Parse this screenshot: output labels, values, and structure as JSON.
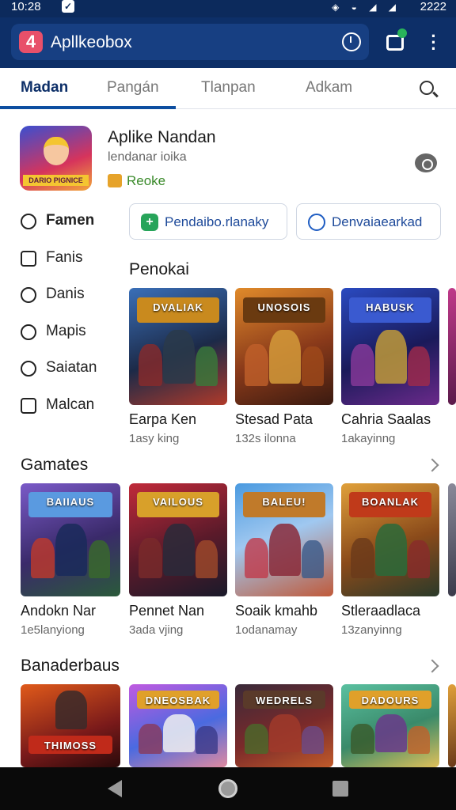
{
  "status": {
    "time": "10:28",
    "right": "2222"
  },
  "header": {
    "logo": "4",
    "title": "Apllkeobox"
  },
  "tabs": [
    {
      "label": "Madan",
      "active": true
    },
    {
      "label": "Pangán",
      "active": false
    },
    {
      "label": "Tlanpan",
      "active": false
    },
    {
      "label": "Adkam",
      "active": false
    }
  ],
  "featured": {
    "icon_text": "DARIO PIGNICE",
    "title": "Aplike Nandan",
    "subtitle": "lendanar ioika",
    "tag": "Reoke"
  },
  "side_nav": [
    {
      "label": "Famen",
      "icon": "pencil-icon",
      "active": true
    },
    {
      "label": "Fanis",
      "icon": "edit-square-icon",
      "active": false
    },
    {
      "label": "Danis",
      "icon": "user-search-icon",
      "active": false
    },
    {
      "label": "Mapis",
      "icon": "clock-icon",
      "active": false
    },
    {
      "label": "Saiatan",
      "icon": "person-icon",
      "active": false
    },
    {
      "label": "Malcan",
      "icon": "window-icon",
      "active": false
    }
  ],
  "chips": [
    {
      "label": "Pendaibo.rlanaky",
      "icon": "add-square-icon"
    },
    {
      "label": "Denvaiaearkad",
      "icon": "search-people-icon"
    }
  ],
  "sections": [
    {
      "title": "Penokai",
      "cards": [
        {
          "name": "Earpa Ken",
          "meta": "1asy king",
          "banner": "DVALIAK"
        },
        {
          "name": "Stesad Pata",
          "meta": "132s ilonna",
          "banner": "UNOSOIS"
        },
        {
          "name": "Cahria Saalas",
          "meta": "1akayinng",
          "banner": "HABUSK"
        }
      ]
    },
    {
      "title": "Gamates",
      "cards": [
        {
          "name": "Andokn Nar",
          "meta": "1e5lanyiong",
          "banner": "BAIIAUS"
        },
        {
          "name": "Pennet Nan",
          "meta": "3ada vjing",
          "banner": "VAILOUS"
        },
        {
          "name": "Soaik kmahb",
          "meta": "1odanamay",
          "banner": "BALEU!"
        },
        {
          "name": "Stleraadlaca",
          "meta": "13zanyinng",
          "banner": "BOANLAK"
        }
      ]
    },
    {
      "title": "Banaderbaus",
      "cards": [
        {
          "name": "",
          "meta": "",
          "banner": "THIMOSS"
        },
        {
          "name": "",
          "meta": "",
          "banner": "DNEOSBAK"
        },
        {
          "name": "",
          "meta": "",
          "banner": "WEDRELS"
        },
        {
          "name": "",
          "meta": "",
          "banner": "DADOURS"
        }
      ]
    }
  ]
}
